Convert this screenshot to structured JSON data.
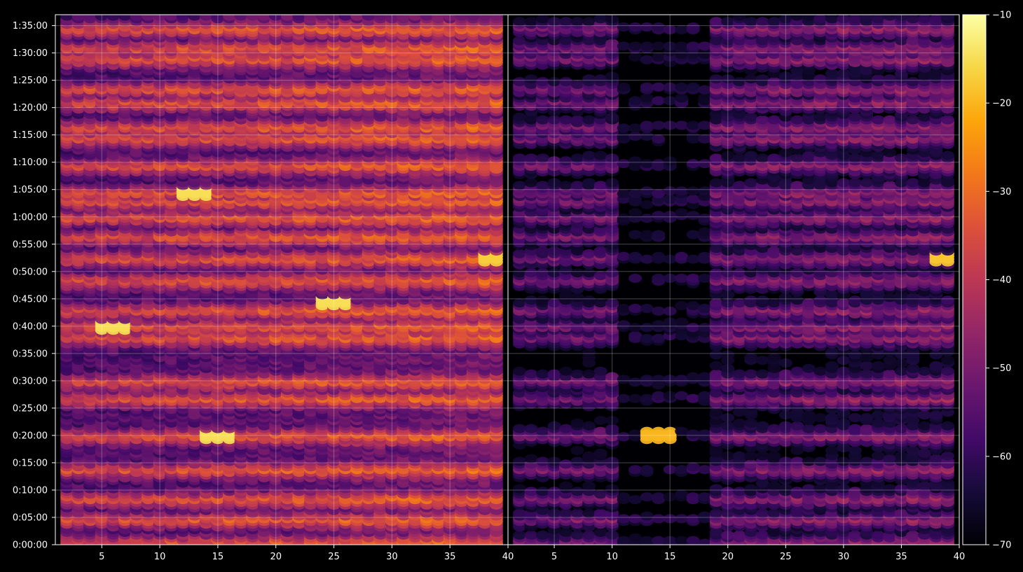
{
  "chart_data": {
    "type": "heatmap",
    "title": "",
    "panels": [
      {
        "name": "",
        "x_ticks": [
          "5",
          "10",
          "15",
          "20",
          "25",
          "30",
          "35",
          "40"
        ],
        "xlim": [
          1,
          40
        ]
      },
      {
        "name": "",
        "x_ticks": [
          "5",
          "10",
          "15",
          "20",
          "25",
          "30",
          "35",
          "40"
        ],
        "xlim": [
          1,
          40
        ]
      }
    ],
    "y_ticks": [
      "0:00:00",
      "0:05:00",
      "0:10:00",
      "0:15:00",
      "0:20:00",
      "0:25:00",
      "0:30:00",
      "0:35:00",
      "0:40:00",
      "0:45:00",
      "0:50:00",
      "0:55:00",
      "1:00:00",
      "1:05:00",
      "1:10:00",
      "1:15:00",
      "1:20:00",
      "1:25:00",
      "1:30:00",
      "1:35:00"
    ],
    "ylim_seconds": [
      0,
      5820
    ],
    "colorbar": {
      "colormap": "inferno",
      "range": [
        -70,
        -10
      ],
      "ticks": [
        "−70",
        "−60",
        "−50",
        "−40",
        "−30",
        "−20",
        "−10"
      ]
    },
    "grid": true,
    "approx_level_summary": {
      "left_panel_typical_db": -35,
      "right_panel_typical_db": -50,
      "band_times": [
        "0:00:30",
        "0:04:40",
        "0:08:30",
        "0:13:50",
        "0:20:00",
        "0:26:50",
        "0:30:00",
        "0:38:00",
        "0:40:00",
        "0:43:00",
        "0:48:30",
        "0:52:30",
        "0:56:30",
        "1:00:00",
        "1:03:00",
        "1:04:30",
        "1:09:30",
        "1:14:30",
        "1:16:30",
        "1:21:00",
        "1:23:30",
        "1:29:00",
        "1:31:00",
        "1:34:30"
      ],
      "hot_spots": [
        {
          "panel": 1,
          "x": 6,
          "t": "0:40:00",
          "db": -15
        },
        {
          "panel": 1,
          "x": 13,
          "t": "1:04:30",
          "db": -15
        },
        {
          "panel": 1,
          "x": 15,
          "t": "0:20:00",
          "db": -15
        },
        {
          "panel": 1,
          "x": 25,
          "t": "0:44:30",
          "db": -15
        },
        {
          "panel": 1,
          "x": 39,
          "t": "0:52:30",
          "db": -17
        },
        {
          "panel": 2,
          "x": 39,
          "t": "0:52:30",
          "db": -18
        },
        {
          "panel": 2,
          "x": 14,
          "t": "0:20:00",
          "db": -20
        }
      ]
    }
  }
}
